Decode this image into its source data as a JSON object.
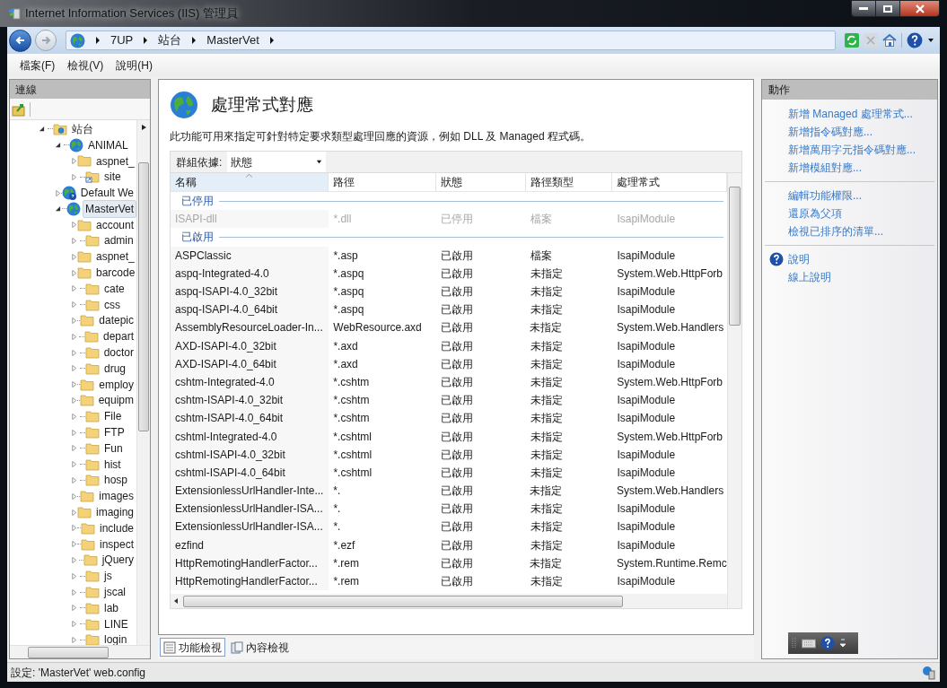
{
  "window": {
    "title": "Internet Information Services (IIS) 管理員"
  },
  "breadcrumb": [
    "7UP",
    "站台",
    "MasterVet"
  ],
  "menu": [
    "檔案(F)",
    "檢視(V)",
    "說明(H)"
  ],
  "connections": {
    "title": "連線",
    "tree": [
      {
        "label": "站台",
        "kind": "sites",
        "expanded": true,
        "selected": false,
        "children": [
          {
            "label": "ANIMAL",
            "kind": "site",
            "expanded": true,
            "selected": false,
            "children": [
              {
                "label": "aspnet_",
                "kind": "folder",
                "expanded": false,
                "selected": false
              },
              {
                "label": "site",
                "kind": "shortcut",
                "expanded": false,
                "selected": false
              }
            ]
          },
          {
            "label": "Default We",
            "kind": "site-help",
            "expanded": false,
            "selected": false
          },
          {
            "label": "MasterVet",
            "kind": "site",
            "expanded": true,
            "selected": true,
            "children": [
              {
                "label": "account",
                "kind": "folder",
                "expanded": false,
                "selected": false
              },
              {
                "label": "admin",
                "kind": "folder",
                "expanded": false,
                "selected": false
              },
              {
                "label": "aspnet_",
                "kind": "folder",
                "expanded": false,
                "selected": false
              },
              {
                "label": "barcode",
                "kind": "folder",
                "expanded": false,
                "selected": false
              },
              {
                "label": "cate",
                "kind": "folder",
                "expanded": false,
                "selected": false
              },
              {
                "label": "css",
                "kind": "folder",
                "expanded": false,
                "selected": false
              },
              {
                "label": "datepic",
                "kind": "folder",
                "expanded": false,
                "selected": false
              },
              {
                "label": "depart",
                "kind": "folder",
                "expanded": false,
                "selected": false
              },
              {
                "label": "doctor",
                "kind": "folder",
                "expanded": false,
                "selected": false
              },
              {
                "label": "drug",
                "kind": "folder",
                "expanded": false,
                "selected": false
              },
              {
                "label": "employ",
                "kind": "folder",
                "expanded": false,
                "selected": false
              },
              {
                "label": "equipm",
                "kind": "folder",
                "expanded": false,
                "selected": false
              },
              {
                "label": "File",
                "kind": "folder",
                "expanded": false,
                "selected": false
              },
              {
                "label": "FTP",
                "kind": "folder",
                "expanded": false,
                "selected": false
              },
              {
                "label": "Fun",
                "kind": "folder",
                "expanded": false,
                "selected": false
              },
              {
                "label": "hist",
                "kind": "folder",
                "expanded": false,
                "selected": false
              },
              {
                "label": "hosp",
                "kind": "folder",
                "expanded": false,
                "selected": false
              },
              {
                "label": "images",
                "kind": "folder",
                "expanded": false,
                "selected": false
              },
              {
                "label": "imaging",
                "kind": "folder",
                "expanded": false,
                "selected": false
              },
              {
                "label": "include",
                "kind": "folder",
                "expanded": false,
                "selected": false
              },
              {
                "label": "inspect",
                "kind": "folder",
                "expanded": false,
                "selected": false
              },
              {
                "label": "jQuery",
                "kind": "folder",
                "expanded": false,
                "selected": false
              },
              {
                "label": "js",
                "kind": "folder",
                "expanded": false,
                "selected": false
              },
              {
                "label": "jscal",
                "kind": "folder",
                "expanded": false,
                "selected": false
              },
              {
                "label": "lab",
                "kind": "folder",
                "expanded": false,
                "selected": false
              },
              {
                "label": "LINE",
                "kind": "folder",
                "expanded": false,
                "selected": false
              },
              {
                "label": "login",
                "kind": "folder",
                "expanded": false,
                "selected": false
              }
            ]
          }
        ]
      }
    ]
  },
  "feature": {
    "title": "處理常式對應",
    "description": "此功能可用來指定可針對特定要求類型處理回應的資源，例如 DLL 及 Managed 程式碼。",
    "group_by": {
      "label": "群組依據:",
      "value": "狀態"
    },
    "columns": [
      {
        "label": "名稱",
        "sorted": true
      },
      {
        "label": "路徑",
        "sorted": false
      },
      {
        "label": "狀態",
        "sorted": false
      },
      {
        "label": "路徑類型",
        "sorted": false
      },
      {
        "label": "處理常式",
        "sorted": false
      }
    ],
    "groups": [
      {
        "label": "已停用",
        "rows": [
          {
            "cells": [
              "ISAPI-dll",
              "*.dll",
              "已停用",
              "檔案",
              "IsapiModule"
            ],
            "disabled": true
          }
        ]
      },
      {
        "label": "已啟用",
        "rows": [
          {
            "cells": [
              "ASPClassic",
              "*.asp",
              "已啟用",
              "檔案",
              "IsapiModule"
            ],
            "disabled": false
          },
          {
            "cells": [
              "aspq-Integrated-4.0",
              "*.aspq",
              "已啟用",
              "未指定",
              "System.Web.HttpForb"
            ],
            "disabled": false
          },
          {
            "cells": [
              "aspq-ISAPI-4.0_32bit",
              "*.aspq",
              "已啟用",
              "未指定",
              "IsapiModule"
            ],
            "disabled": false
          },
          {
            "cells": [
              "aspq-ISAPI-4.0_64bit",
              "*.aspq",
              "已啟用",
              "未指定",
              "IsapiModule"
            ],
            "disabled": false
          },
          {
            "cells": [
              "AssemblyResourceLoader-In...",
              "WebResource.axd",
              "已啟用",
              "未指定",
              "System.Web.Handlers"
            ],
            "disabled": false
          },
          {
            "cells": [
              "AXD-ISAPI-4.0_32bit",
              "*.axd",
              "已啟用",
              "未指定",
              "IsapiModule"
            ],
            "disabled": false
          },
          {
            "cells": [
              "AXD-ISAPI-4.0_64bit",
              "*.axd",
              "已啟用",
              "未指定",
              "IsapiModule"
            ],
            "disabled": false
          },
          {
            "cells": [
              "cshtm-Integrated-4.0",
              "*.cshtm",
              "已啟用",
              "未指定",
              "System.Web.HttpForb"
            ],
            "disabled": false
          },
          {
            "cells": [
              "cshtm-ISAPI-4.0_32bit",
              "*.cshtm",
              "已啟用",
              "未指定",
              "IsapiModule"
            ],
            "disabled": false
          },
          {
            "cells": [
              "cshtm-ISAPI-4.0_64bit",
              "*.cshtm",
              "已啟用",
              "未指定",
              "IsapiModule"
            ],
            "disabled": false
          },
          {
            "cells": [
              "cshtml-Integrated-4.0",
              "*.cshtml",
              "已啟用",
              "未指定",
              "System.Web.HttpForb"
            ],
            "disabled": false
          },
          {
            "cells": [
              "cshtml-ISAPI-4.0_32bit",
              "*.cshtml",
              "已啟用",
              "未指定",
              "IsapiModule"
            ],
            "disabled": false
          },
          {
            "cells": [
              "cshtml-ISAPI-4.0_64bit",
              "*.cshtml",
              "已啟用",
              "未指定",
              "IsapiModule"
            ],
            "disabled": false
          },
          {
            "cells": [
              "ExtensionlessUrlHandler-Inte...",
              "*.",
              "已啟用",
              "未指定",
              "System.Web.Handlers"
            ],
            "disabled": false
          },
          {
            "cells": [
              "ExtensionlessUrlHandler-ISA...",
              "*.",
              "已啟用",
              "未指定",
              "IsapiModule"
            ],
            "disabled": false
          },
          {
            "cells": [
              "ExtensionlessUrlHandler-ISA...",
              "*.",
              "已啟用",
              "未指定",
              "IsapiModule"
            ],
            "disabled": false
          },
          {
            "cells": [
              "ezfind",
              "*.ezf",
              "已啟用",
              "未指定",
              "IsapiModule"
            ],
            "disabled": false
          },
          {
            "cells": [
              "HttpRemotingHandlerFactor...",
              "*.rem",
              "已啟用",
              "未指定",
              "System.Runtime.Remc"
            ],
            "disabled": false
          },
          {
            "cells": [
              "HttpRemotingHandlerFactor...",
              "*.rem",
              "已啟用",
              "未指定",
              "IsapiModule"
            ],
            "disabled": false
          }
        ]
      }
    ]
  },
  "view_tabs": [
    {
      "label": "功能檢視",
      "selected": true
    },
    {
      "label": "內容檢視",
      "selected": false
    }
  ],
  "actions": {
    "title": "動作",
    "sections": [
      [
        {
          "label": "新增 Managed 處理常式...",
          "kind": "link"
        },
        {
          "label": "新增指令碼對應...",
          "kind": "link"
        },
        {
          "label": "新增萬用字元指令碼對應...",
          "kind": "link"
        },
        {
          "label": "新增模組對應...",
          "kind": "link"
        }
      ],
      [
        {
          "label": "編輯功能權限...",
          "kind": "link"
        },
        {
          "label": "還原為父項",
          "kind": "link"
        },
        {
          "label": "檢視已排序的清單...",
          "kind": "link"
        }
      ],
      [
        {
          "label": "說明",
          "kind": "help"
        },
        {
          "label": "線上說明",
          "kind": "link"
        }
      ]
    ]
  },
  "status_bar": {
    "text": "設定: 'MasterVet' web.config"
  }
}
